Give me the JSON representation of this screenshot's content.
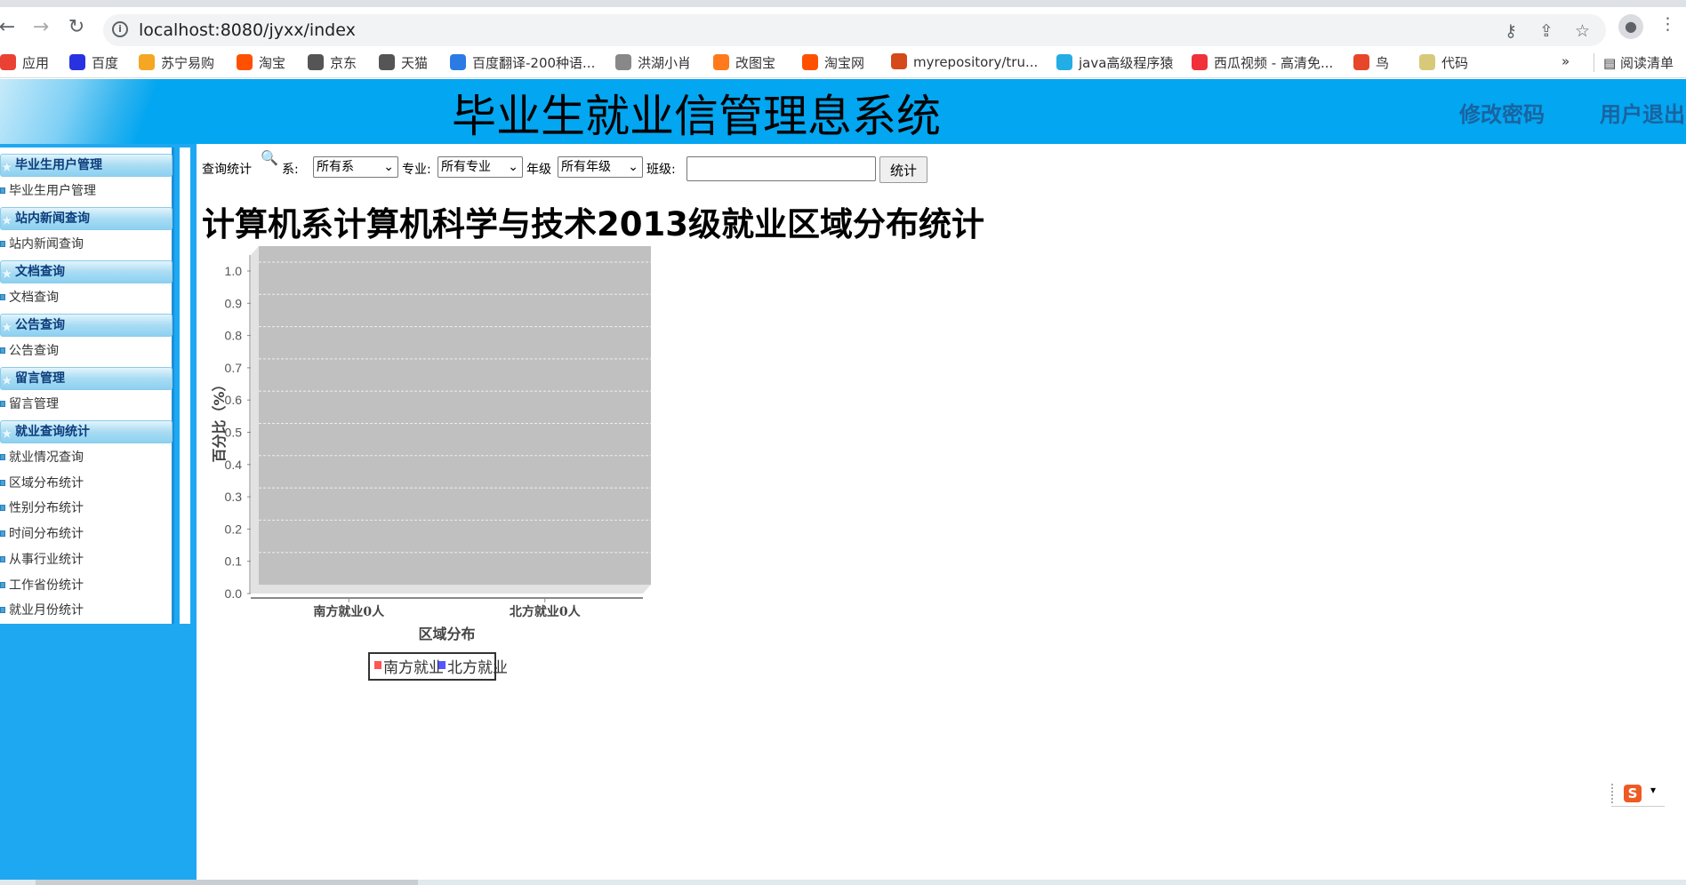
{
  "browser": {
    "url": "localhost:8080/jyxx/index",
    "bookmarks": [
      {
        "label": "应用",
        "color": "#e94235"
      },
      {
        "label": "百度",
        "color": "#2932e1"
      },
      {
        "label": "苏宁易购",
        "color": "#f5a623"
      },
      {
        "label": "淘宝",
        "color": "#ff5000"
      },
      {
        "label": "京东",
        "color": "#555555"
      },
      {
        "label": "天猫",
        "color": "#555555"
      },
      {
        "label": "百度翻译-200种语...",
        "color": "#2b7be4"
      },
      {
        "label": "洪湖小肖",
        "color": "#888888"
      },
      {
        "label": "改图宝",
        "color": "#ff7a1a"
      },
      {
        "label": "淘宝网",
        "color": "#ff5000"
      },
      {
        "label": "myrepository/tru...",
        "color": "#d44a1a"
      },
      {
        "label": "java高级程序猿",
        "color": "#23ade5"
      },
      {
        "label": "西瓜视频 - 高清免...",
        "color": "#f0303a"
      },
      {
        "label": "鸟",
        "color": "#e8462a"
      },
      {
        "label": "代码",
        "color": "#d8c97a"
      }
    ],
    "more": "»",
    "reading_list": "阅读清单"
  },
  "header": {
    "title": "毕业生就业信管理息系统",
    "change_password": "修改密码",
    "logout": "用户退出"
  },
  "sidebar": {
    "groups": [
      {
        "title": "毕业生用户管理",
        "items": [
          "毕业生用户管理"
        ]
      },
      {
        "title": "站内新闻查询",
        "items": [
          "站内新闻查询"
        ]
      },
      {
        "title": "文档查询",
        "items": [
          "文档查询"
        ]
      },
      {
        "title": "公告查询",
        "items": [
          "公告查询"
        ]
      },
      {
        "title": "留言管理",
        "items": [
          "留言管理"
        ]
      },
      {
        "title": "就业查询统计",
        "items": [
          "就业情况查询",
          "区域分布统计",
          "性别分布统计",
          "时间分布统计",
          "从事行业统计",
          "工作省份统计",
          "就业月份统计"
        ]
      }
    ]
  },
  "toolbar": {
    "label": "查询统计",
    "dept_label": "系:",
    "dept_value": "所有系",
    "major_label": "专业:",
    "major_value": "所有专业",
    "grade_label": "年级",
    "grade_value": "所有年级",
    "class_label": "班级:",
    "class_value": "",
    "submit": "统计"
  },
  "page_title": "计算机系计算机科学与技术2013级就业区域分布统计",
  "chart_data": {
    "type": "bar",
    "title": "",
    "xlabel": "区域分布",
    "ylabel": "百分比（%）",
    "categories": [
      "南方就业0人",
      "北方就业0人"
    ],
    "series": [
      {
        "name": "南方就业",
        "color": "#ff5555",
        "values": [
          0,
          0
        ]
      },
      {
        "name": "北方就业",
        "color": "#5555ff",
        "values": [
          0,
          0
        ]
      }
    ],
    "ylim": [
      0,
      1.0
    ],
    "yticks": [
      "0.0",
      "0.1",
      "0.2",
      "0.3",
      "0.4",
      "0.5",
      "0.6",
      "0.7",
      "0.8",
      "0.9",
      "1.0"
    ],
    "grid": true,
    "legend": "bottom"
  }
}
